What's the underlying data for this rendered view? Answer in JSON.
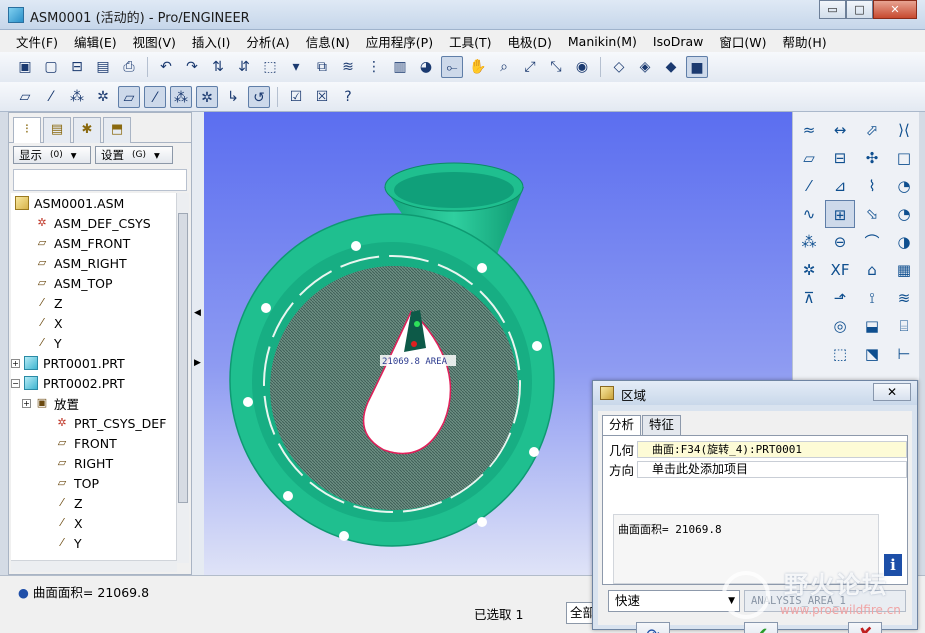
{
  "window": {
    "title": "ASM0001 (活动的) - Pro/ENGINEER",
    "minimize": "▭",
    "maximize": "□",
    "close": "✕"
  },
  "menu": [
    "文件(F)",
    "编辑(E)",
    "视图(V)",
    "插入(I)",
    "分析(A)",
    "信息(N)",
    "应用程序(P)",
    "工具(T)",
    "电极(D)",
    "Manikin(M)",
    "IsoDraw",
    "窗口(W)",
    "帮助(H)"
  ],
  "toolbar1": [
    "new-icon",
    "open-icon",
    "save-icon",
    "save-copy-icon",
    "print-icon",
    "undo-icon",
    "redo-icon",
    "regenerate-icon",
    "regenerate-manager-icon",
    "select-box-icon",
    "copy-icon",
    "layers-icon",
    "view-manager-icon",
    "model-tree-icon",
    "appearance-icon",
    "datum-display-icon",
    "spin-center-icon",
    "drag-icon",
    "zoom-icon",
    "refit-icon",
    "annotation-icon",
    "orient-icon",
    "wireframe-icon",
    "hidden-line-icon",
    "no-hidden-icon",
    "shaded-icon"
  ],
  "toolbar2": [
    "datum-plane-display-icon",
    "datum-axis-display-icon",
    "datum-point-display-icon",
    "csys-display-icon",
    "plane-tag-icon",
    "axis-tag-icon",
    "point-tag-icon",
    "csys-tag-icon",
    "repaint-icon",
    "spin-display-icon",
    "assembly-icon",
    "close-window-icon",
    "context-help-icon"
  ],
  "left_panel": {
    "show_label": "显示",
    "show_shortcut": "(0)",
    "settings_label": "设置",
    "settings_shortcut": "(G)",
    "tree": [
      {
        "label": "ASM0001.ASM",
        "type": "asm",
        "indent": 0
      },
      {
        "label": "ASM_DEF_CSYS",
        "type": "csys",
        "indent": 1
      },
      {
        "label": "ASM_FRONT",
        "type": "plane",
        "indent": 1
      },
      {
        "label": "ASM_RIGHT",
        "type": "plane",
        "indent": 1
      },
      {
        "label": "ASM_TOP",
        "type": "plane",
        "indent": 1
      },
      {
        "label": "Z",
        "type": "axis",
        "indent": 1
      },
      {
        "label": "X",
        "type": "axis",
        "indent": 1
      },
      {
        "label": "Y",
        "type": "axis",
        "indent": 1
      },
      {
        "label": "PRT0001.PRT",
        "type": "part",
        "indent": 0,
        "expander": "+"
      },
      {
        "label": "PRT0002.PRT",
        "type": "part",
        "indent": 0,
        "expander": "−"
      },
      {
        "label": "放置",
        "type": "placement",
        "indent": 1,
        "expander": "+"
      },
      {
        "label": "PRT_CSYS_DEF",
        "type": "csys",
        "indent": 2
      },
      {
        "label": "FRONT",
        "type": "plane",
        "indent": 2
      },
      {
        "label": "RIGHT",
        "type": "plane",
        "indent": 2
      },
      {
        "label": "TOP",
        "type": "plane",
        "indent": 2
      },
      {
        "label": "Z",
        "type": "axis",
        "indent": 2
      },
      {
        "label": "X",
        "type": "axis",
        "indent": 2
      },
      {
        "label": "Y",
        "type": "axis",
        "indent": 2
      }
    ]
  },
  "viewport": {
    "annotation": "21069.8 AREA"
  },
  "status": {
    "message": "曲面面积= 21069.8",
    "selected": "已选取 1",
    "filter": "全部"
  },
  "dialog": {
    "title": "区域",
    "close": "✕",
    "tabs": [
      "分析",
      "特征"
    ],
    "geometry_label": "几何",
    "geometry_value": "曲面:F34(旋转_4):PRT0001",
    "direction_label": "方向",
    "direction_value": "单击此处添加项目",
    "result": "曲面面积= 21069.8",
    "mode": "快速",
    "analysis_name": "ANALYSIS_AREA_1"
  },
  "watermark": {
    "text": "野火论坛",
    "url": "www.proewildfire.cn"
  },
  "colors": {
    "model_green": "#1fbf8f",
    "viewport_top": "#5b6ef0",
    "accent": "#1d4fa8"
  }
}
